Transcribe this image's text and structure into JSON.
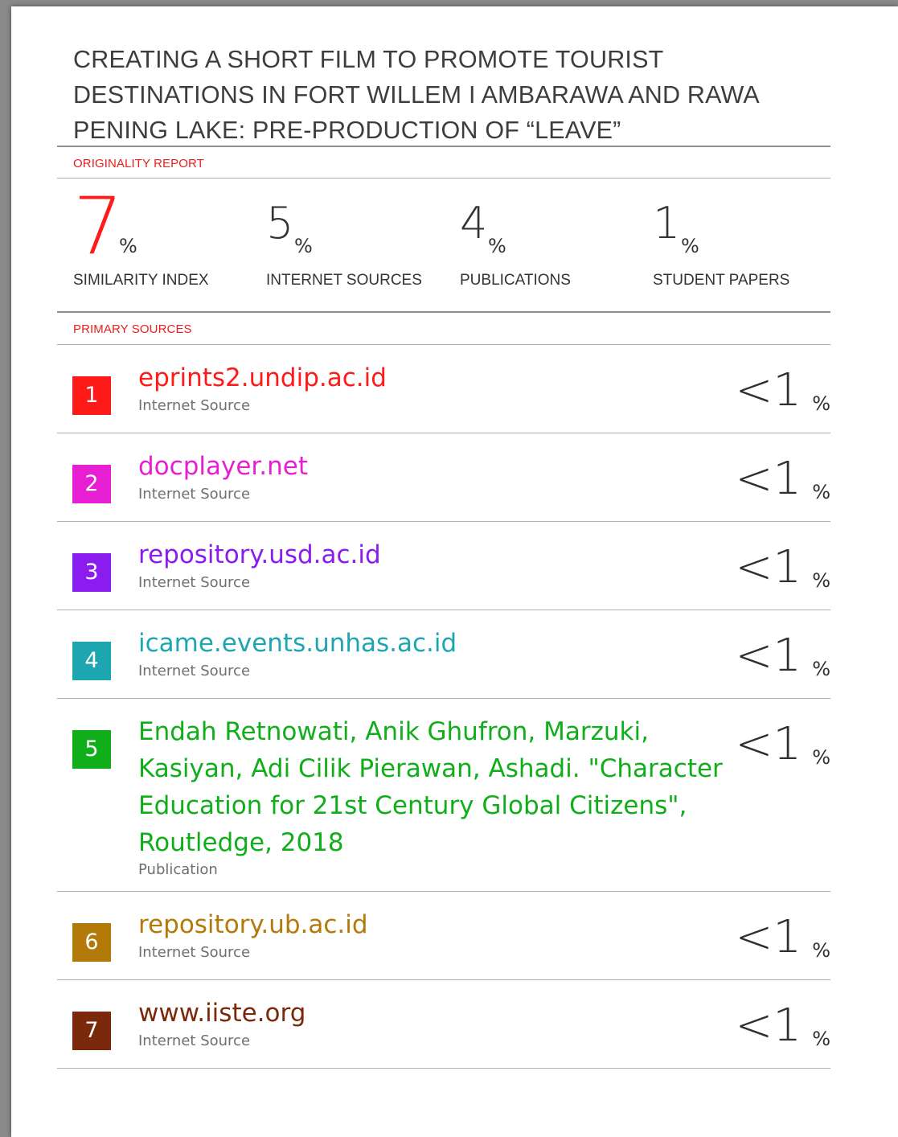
{
  "report": {
    "title": "CREATING A SHORT FILM TO PROMOTE TOURIST DESTINATIONS IN FORT WILLEM I AMBARAWA AND RAWA PENING LAKE: PRE-PRODUCTION OF “LEAVE”",
    "originality_label": "ORIGINALITY REPORT",
    "primary_sources_label": "PRIMARY SOURCES",
    "accent_color": "#e8201f"
  },
  "stats": [
    {
      "value": "7",
      "unit": "%",
      "label": "SIMILARITY INDEX"
    },
    {
      "value": "5",
      "unit": "%",
      "label": "INTERNET SOURCES"
    },
    {
      "value": "4",
      "unit": "%",
      "label": "PUBLICATIONS"
    },
    {
      "value": "1",
      "unit": "%",
      "label": "STUDENT PAPERS"
    }
  ],
  "sources": [
    {
      "rank": "1",
      "name": "eprints2.undip.ac.id",
      "type": "Internet Source",
      "match": "<1",
      "unit": "%",
      "color": "#ff1a1a"
    },
    {
      "rank": "2",
      "name": "docplayer.net",
      "type": "Internet Source",
      "match": "<1",
      "unit": "%",
      "color": "#e620d2"
    },
    {
      "rank": "3",
      "name": "repository.usd.ac.id",
      "type": "Internet Source",
      "match": "<1",
      "unit": "%",
      "color": "#8a1cf0"
    },
    {
      "rank": "4",
      "name": "icame.events.unhas.ac.id",
      "type": "Internet Source",
      "match": "<1",
      "unit": "%",
      "color": "#1ea6b0"
    },
    {
      "rank": "5",
      "name": "Endah Retnowati, Anik Ghufron, Marzuki, Kasiyan, Adi Cilik Pierawan, Ashadi. \"Character Education for 21st Century Global Citizens\", Routledge, 2018",
      "type": "Publication",
      "match": "<1",
      "unit": "%",
      "color": "#0fae1a"
    },
    {
      "rank": "6",
      "name": "repository.ub.ac.id",
      "type": "Internet Source",
      "match": "<1",
      "unit": "%",
      "color": "#b37a0a"
    },
    {
      "rank": "7",
      "name": "www.iiste.org",
      "type": "Internet Source",
      "match": "<1",
      "unit": "%",
      "color": "#7a2a0a"
    }
  ]
}
